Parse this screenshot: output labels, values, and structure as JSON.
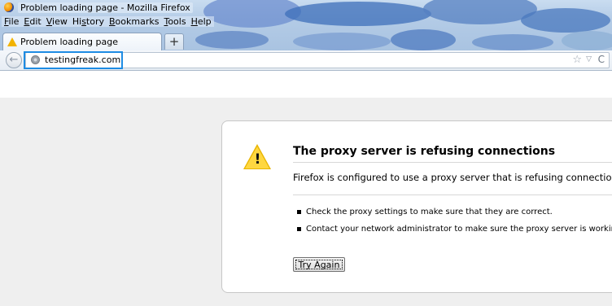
{
  "window": {
    "title": "Problem loading page - Mozilla Firefox",
    "icon": "firefox-logo-icon"
  },
  "menu": [
    {
      "label": "File",
      "accel": "F",
      "rest": "ile"
    },
    {
      "label": "Edit",
      "accel": "E",
      "rest": "dit"
    },
    {
      "label": "View",
      "accel": "V",
      "rest": "iew"
    },
    {
      "label": "History",
      "accel": "",
      "pre": "Hi",
      "accel2": "s",
      "rest": "tory"
    },
    {
      "label": "Bookmarks",
      "accel": "B",
      "rest": "ookmarks"
    },
    {
      "label": "Tools",
      "accel": "T",
      "rest": "ools"
    },
    {
      "label": "Help",
      "accel": "H",
      "rest": "elp"
    }
  ],
  "tabs": [
    {
      "label": "Problem loading page",
      "icon": "warning-icon"
    }
  ],
  "new_tab_label": "+",
  "nav": {
    "back_glyph": "←",
    "url": "testingfreak.com",
    "star_glyph": "☆",
    "dropmarker_glyph": "▽",
    "reload_glyph": "C"
  },
  "error": {
    "title": "The proxy server is refusing connections",
    "short_desc": "Firefox is configured to use a proxy server that is refusing connections.",
    "bullets": [
      "Check the proxy settings to make sure that they are correct.",
      "Contact your network administrator to make sure the proxy server is working."
    ],
    "try_again_label": "Try Again",
    "warning_glyph": "!"
  },
  "colors": {
    "url_highlight": "#1e8ce3",
    "warning_yellow": "#e9b500",
    "chrome_glass": "#b3cbe6"
  }
}
